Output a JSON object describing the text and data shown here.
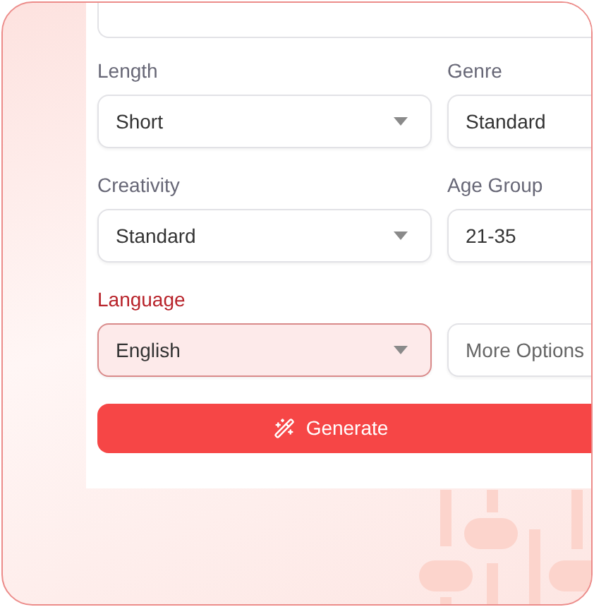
{
  "form": {
    "fields": [
      {
        "label": "Length",
        "value": "Short",
        "kind": "select",
        "active": false
      },
      {
        "label": "Genre",
        "value": "Standard",
        "kind": "field",
        "active": false
      },
      {
        "label": "Creativity",
        "value": "Standard",
        "kind": "select",
        "active": false
      },
      {
        "label": "Age Group",
        "value": "21-35",
        "kind": "field",
        "active": false
      },
      {
        "label": "Language",
        "value": "English",
        "kind": "select",
        "active": true
      },
      {
        "value": "More Options",
        "kind": "button",
        "active": false
      }
    ],
    "generate_button": {
      "label": "Generate"
    }
  }
}
